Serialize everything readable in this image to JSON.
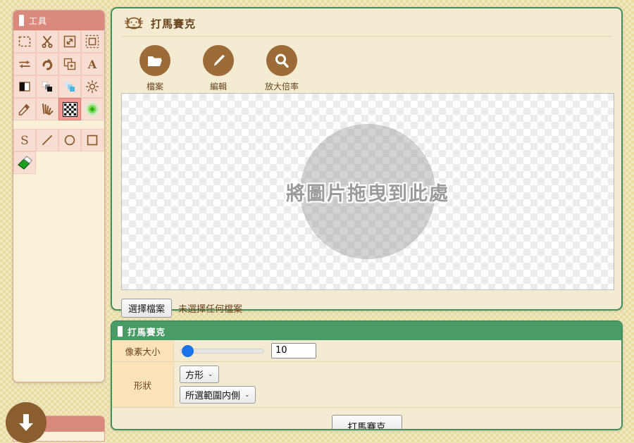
{
  "tools_panel": {
    "title": "工具",
    "icons": [
      {
        "name": "select-rectangle-icon",
        "glyph": "dashed-rect",
        "selected": false
      },
      {
        "name": "scissors-cut-icon",
        "glyph": "scissors",
        "selected": false
      },
      {
        "name": "resize-icon",
        "glyph": "resize",
        "selected": false
      },
      {
        "name": "crop-icon",
        "glyph": "crop",
        "selected": false
      },
      {
        "name": "flip-icon",
        "glyph": "flip",
        "selected": false
      },
      {
        "name": "rotate-icon",
        "glyph": "rotate",
        "selected": false
      },
      {
        "name": "duplicate-layer-icon",
        "glyph": "addlayer",
        "selected": false
      },
      {
        "name": "text-tool-icon",
        "glyph": "text",
        "selected": false
      },
      {
        "name": "contrast-icon",
        "glyph": "contrast",
        "selected": false
      },
      {
        "name": "grayscale-icon",
        "glyph": "grayscale",
        "selected": false
      },
      {
        "name": "colorize-icon",
        "glyph": "colorize",
        "selected": false
      },
      {
        "name": "brightness-icon",
        "glyph": "brightness",
        "selected": false
      },
      {
        "name": "eyedropper-icon",
        "glyph": "eyedropper",
        "selected": false
      },
      {
        "name": "smudge-icon",
        "glyph": "smudge",
        "selected": false
      },
      {
        "name": "mosaic-icon",
        "glyph": "mosaic",
        "selected": true
      },
      {
        "name": "glow-blur-icon",
        "glyph": "glow",
        "selected": false
      },
      {
        "name": "curve-tool-icon",
        "glyph": "curve",
        "selected": false
      },
      {
        "name": "line-tool-icon",
        "glyph": "line",
        "selected": false
      },
      {
        "name": "ellipse-tool-icon",
        "glyph": "ellipse",
        "selected": false
      },
      {
        "name": "rectangle-tool-icon",
        "glyph": "rect",
        "selected": false
      },
      {
        "name": "eraser-icon",
        "glyph": "eraser",
        "selected": false
      }
    ]
  },
  "editor": {
    "title": "打馬賽克",
    "logo_icon": "cat-face-icon",
    "tools": [
      {
        "icon": "folder-open-icon",
        "label": "檔案"
      },
      {
        "icon": "pencil-edit-icon",
        "label": "編輯"
      },
      {
        "icon": "magnifier-zoom-icon",
        "label": "放大倍率"
      }
    ],
    "canvas": {
      "drop_hint": "將圖片拖曳到此處"
    },
    "file_input": {
      "button_label": "選擇檔案",
      "status_text": "未選擇任何檔案"
    }
  },
  "settings": {
    "title": "打馬賽克",
    "rows": [
      {
        "label": "像素大小",
        "value": "10"
      },
      {
        "label": "形狀"
      }
    ],
    "shape_select": "方形",
    "region_select": "所選範圍内側",
    "caret": "⌄",
    "apply_label": "打馬賽克"
  },
  "floating": {
    "download_icon": "download-arrow-icon"
  },
  "colors": {
    "background": "#e8dca4",
    "panel_bg": "#f3ecd2",
    "panel_border_green": "#3f8f5f",
    "tools_header": "#d98a7c",
    "settings_header": "#4a9c67",
    "brown_accent": "#9c6b38",
    "label_cell": "#fbe2b8",
    "slider_thumb": "#1a73e8"
  }
}
